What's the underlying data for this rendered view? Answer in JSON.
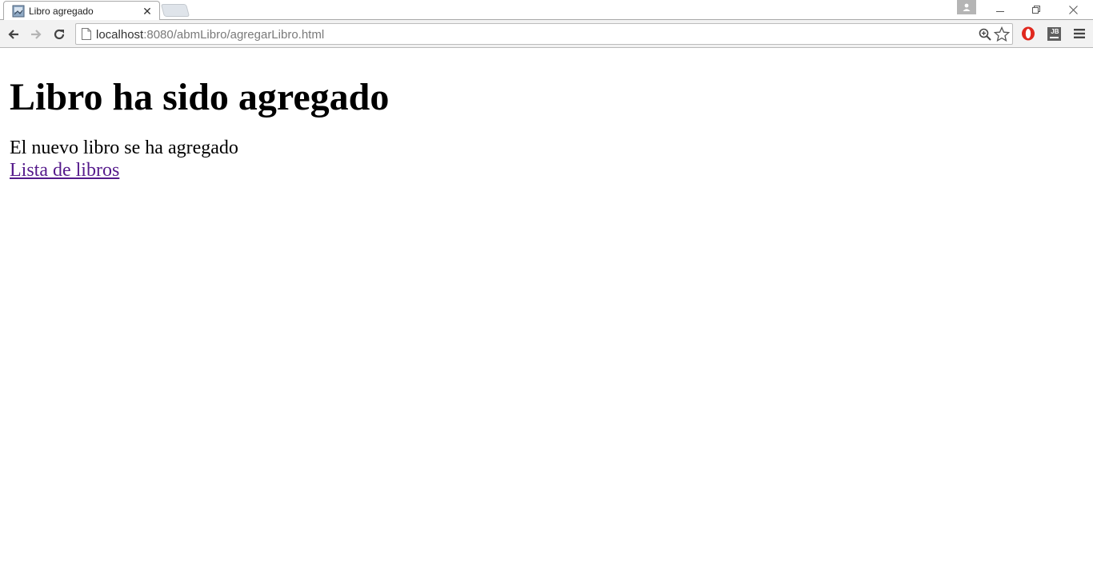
{
  "browser": {
    "tab": {
      "title": "Libro agregado",
      "favicon": "page-favicon-icon",
      "close_glyph": "✕"
    },
    "window_controls": [
      "minimize-icon",
      "restore-icon",
      "close-icon"
    ],
    "address_bar": {
      "host": "localhost",
      "rest": ":8080/abmLibro/agregarLibro.html"
    },
    "extensions": [
      "opera-icon",
      "jb-icon"
    ],
    "jb_label": "JB"
  },
  "page": {
    "heading": "Libro ha sido agregado",
    "message": "El nuevo libro se ha agregado",
    "link_label": "Lista de libros"
  },
  "colors": {
    "visited_link": "#551a8b",
    "opera_red": "#e0281e"
  }
}
